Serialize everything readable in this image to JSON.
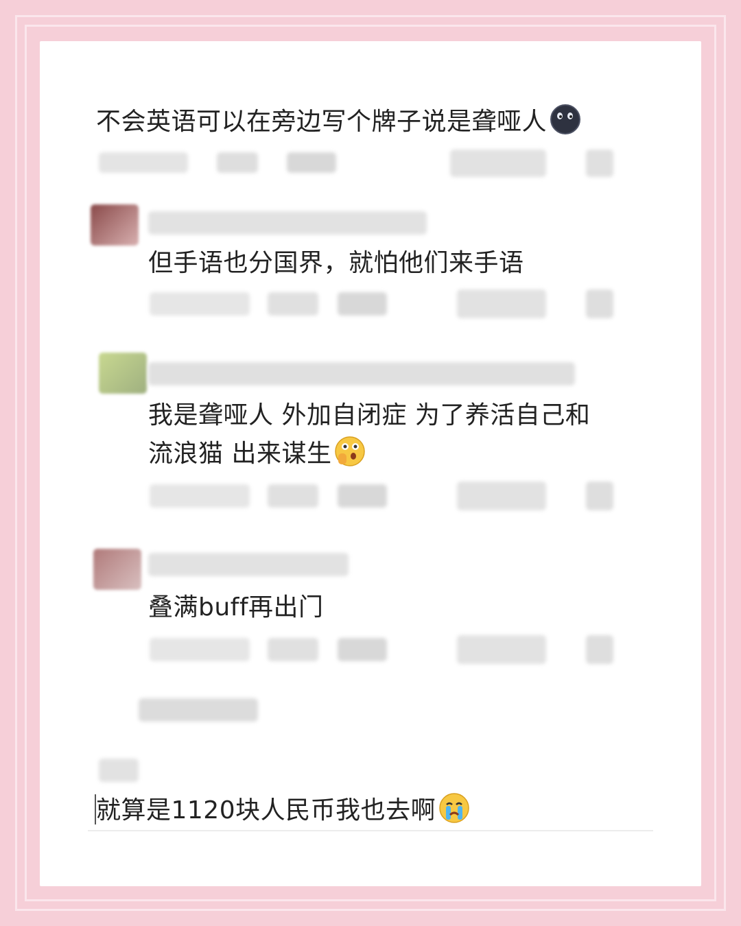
{
  "comments": [
    {
      "id": "c1",
      "text": "不会英语可以在旁边写个牌子说是聋哑人",
      "emoji": "dark-moon-face-emoji"
    },
    {
      "id": "c2",
      "text": "但手语也分国界，就怕他们来手语"
    },
    {
      "id": "c3",
      "line1": "我是聋哑人 外加自闭症 为了养活自己和",
      "line2": "流浪猫 出来谋生",
      "emoji": "shushing-face-emoji"
    },
    {
      "id": "c4",
      "text": "叠满buff再出门"
    }
  ],
  "composer": {
    "text": "就算是1120块人民币我也去啊",
    "emoji": "crying-face-emoji"
  },
  "colors": {
    "background": "#f6cfd8",
    "card": "#ffffff",
    "text": "#222222"
  }
}
